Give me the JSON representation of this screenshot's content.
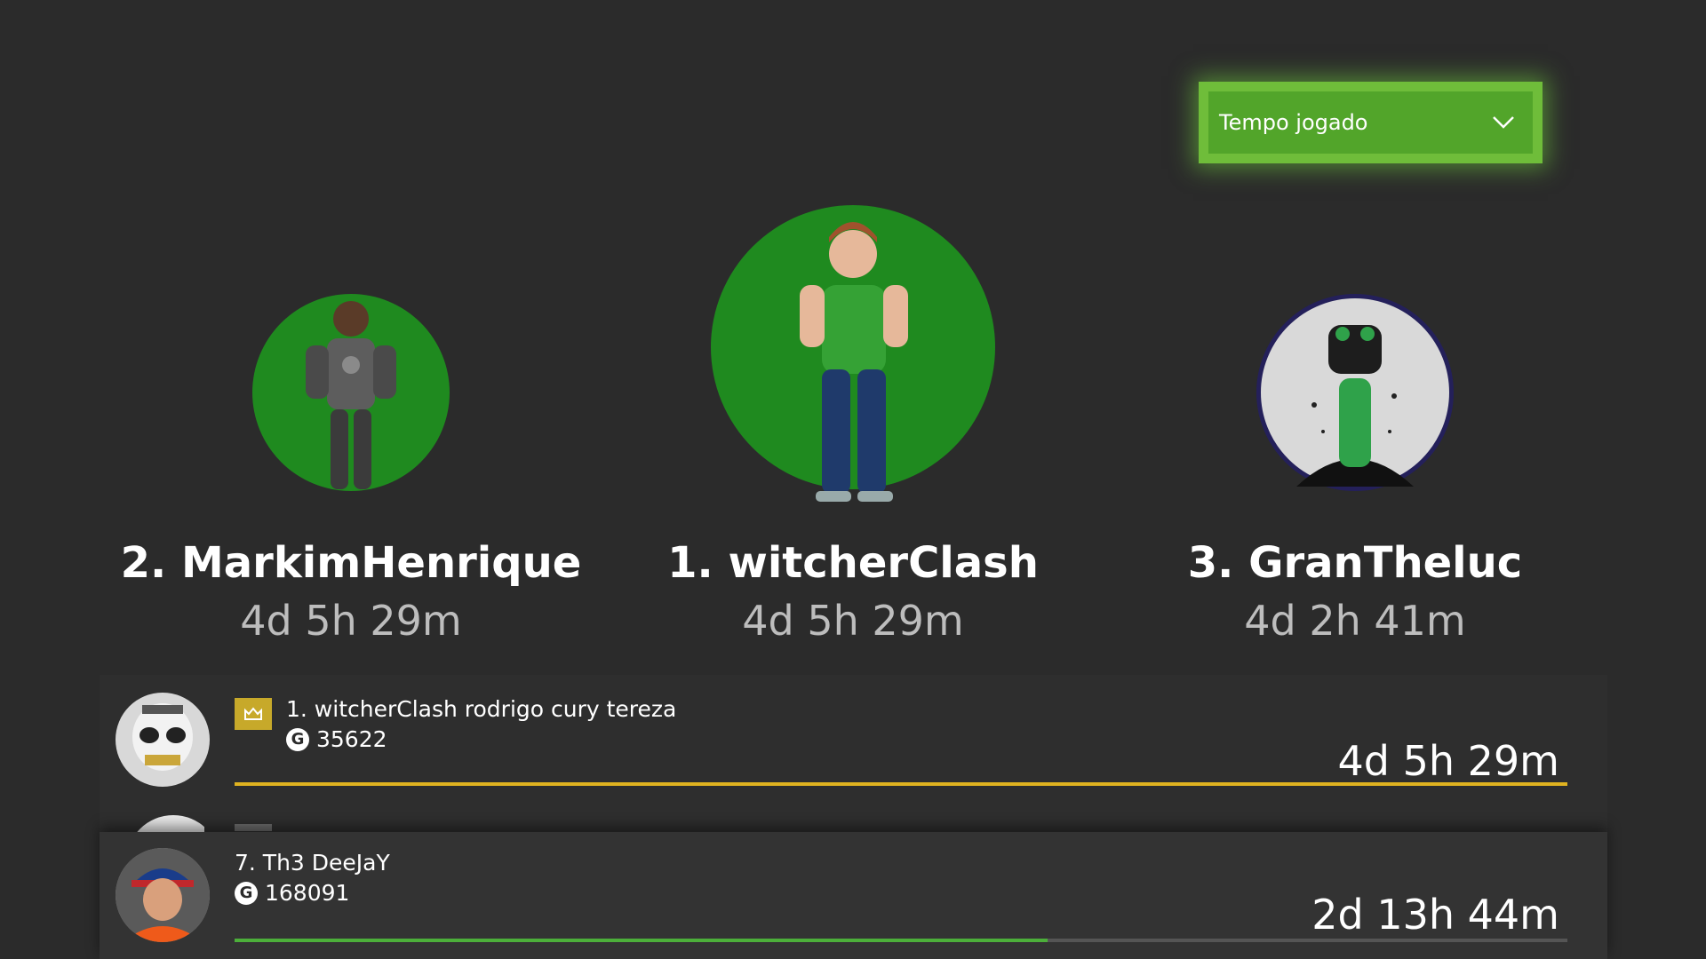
{
  "filter": {
    "selected": "Tempo jogado"
  },
  "podium": [
    {
      "rank_name": "2. MarkimHenrique",
      "time": "4d 5h 29m"
    },
    {
      "rank_name": "1. witcherClash",
      "time": "4d 5h 29m"
    },
    {
      "rank_name": "3. GranTheluc",
      "time": "4d 2h 41m"
    }
  ],
  "leaderboard": [
    {
      "name": "1. witcherClash  rodrigo cury tereza",
      "score": "35622",
      "time": "4d 5h 29m",
      "progress": 1.0,
      "bar_color": "#e0b320"
    },
    {
      "name": "7. Th3 DeeJaY",
      "score": "168091",
      "time": "2d 13h 44m",
      "progress": 0.61,
      "bar_color": "#4caf3a"
    }
  ],
  "gamerscore_icon": "G",
  "colors": {
    "accent": "#52a52a",
    "gold": "#e0b320",
    "green_progress": "#4caf3a"
  },
  "icons": [
    "chevron-down-icon",
    "crown-icon",
    "gamerscore-icon"
  ]
}
